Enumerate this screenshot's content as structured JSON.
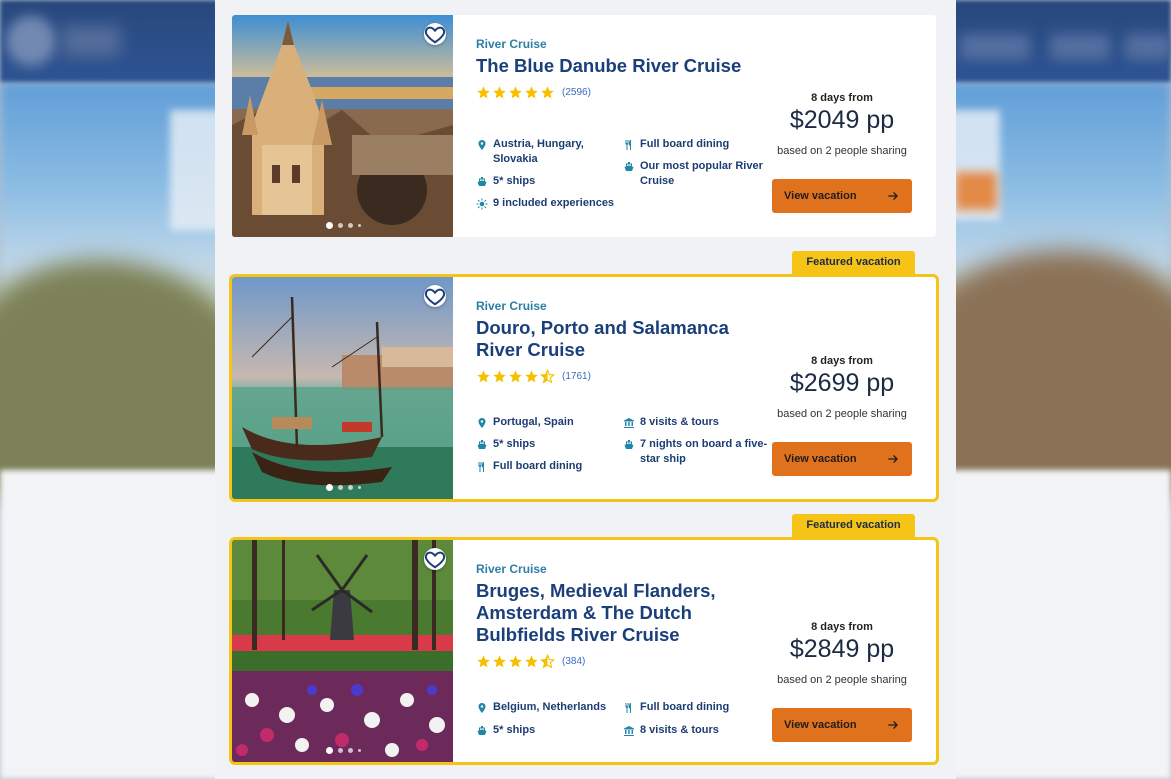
{
  "colors": {
    "category": "#2d7fa3",
    "title": "#1a3f7a",
    "star": "#f6c000",
    "button": "#e0711d",
    "featured_border": "#f6c416",
    "feature_icon": "#1f86a8"
  },
  "cards": [
    {
      "category": "River Cruise",
      "title": "The Blue Danube River Cruise",
      "stars": 5,
      "reviews": "(2596)",
      "features": [
        {
          "icon": "location-icon",
          "text": "Austria, Hungary, Slovakia"
        },
        {
          "icon": "dining-icon",
          "text": "Full board dining"
        },
        {
          "icon": "ship-icon",
          "text": "5* ships"
        },
        {
          "icon": "ship-icon",
          "text": "Our most popular River Cruise"
        },
        {
          "icon": "sun-icon",
          "text": "9 included experiences"
        }
      ],
      "days_from": "8 days from",
      "price": "$2049 pp",
      "sharing": "based on 2 people sharing",
      "button": "View vacation",
      "featured": false
    },
    {
      "category": "River Cruise",
      "title": "Douro, Porto and Salamanca River Cruise",
      "stars": 4.5,
      "reviews": "(1761)",
      "features": [
        {
          "icon": "location-icon",
          "text": "Portugal, Spain"
        },
        {
          "icon": "museum-icon",
          "text": "8 visits & tours"
        },
        {
          "icon": "ship-icon",
          "text": "5* ships"
        },
        {
          "icon": "ship-icon",
          "text": "7 nights on board a five-star ship"
        },
        {
          "icon": "dining-icon",
          "text": "Full board dining"
        }
      ],
      "days_from": "8 days from",
      "price": "$2699 pp",
      "sharing": "based on 2 people sharing",
      "button": "View vacation",
      "featured": true,
      "badge": "Featured vacation"
    },
    {
      "category": "River Cruise",
      "title": "Bruges, Medieval Flanders, Amsterdam & The Dutch Bulbfields River Cruise",
      "stars": 4.5,
      "reviews": "(384)",
      "features": [
        {
          "icon": "location-icon",
          "text": "Belgium, Netherlands"
        },
        {
          "icon": "dining-icon",
          "text": "Full board dining"
        },
        {
          "icon": "ship-icon",
          "text": "5* ships"
        },
        {
          "icon": "museum-icon",
          "text": "8 visits & tours"
        }
      ],
      "days_from": "8 days from",
      "price": "$2849 pp",
      "sharing": "based on 2 people sharing",
      "button": "View vacation",
      "featured": true,
      "badge": "Featured vacation"
    }
  ]
}
